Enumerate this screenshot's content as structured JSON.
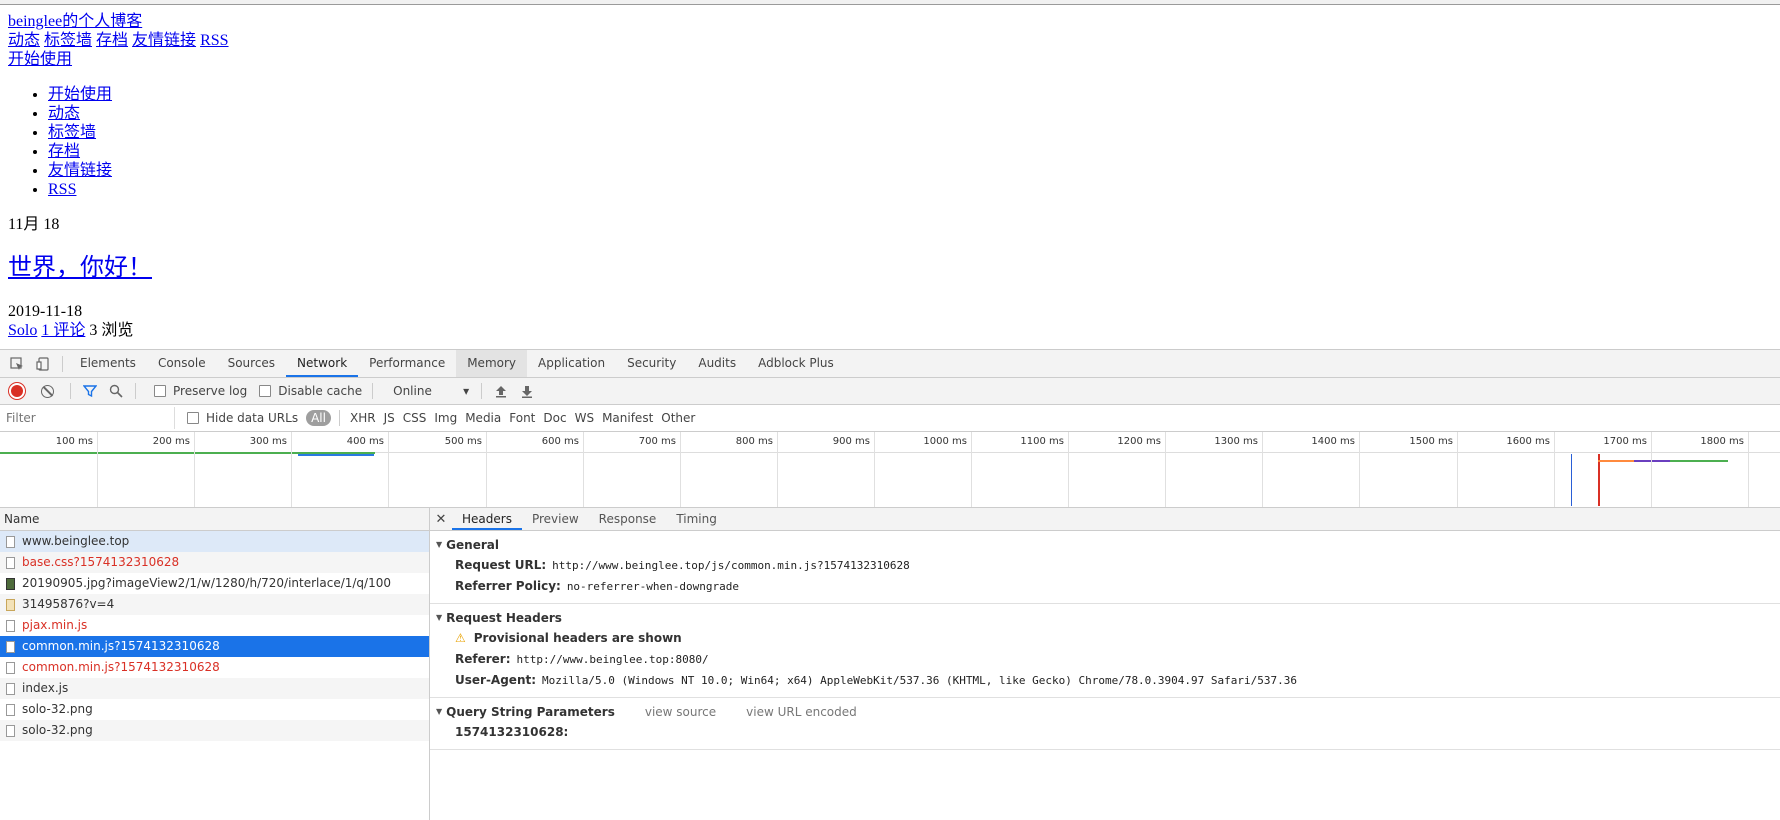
{
  "page": {
    "site_title": "beinglee的个人博客",
    "nav_links": [
      "动态",
      "标签墙",
      "存档",
      "友情链接",
      "RSS"
    ],
    "start_link": "开始使用",
    "menu": [
      "开始使用",
      "动态",
      "标签墙",
      "存档",
      "友情链接",
      "RSS"
    ],
    "date_month": "11月 18",
    "post_title": "世界，你好！",
    "post_date": "2019-11-18",
    "post_author": "Solo",
    "post_comments": "1 评论",
    "post_views": "3 浏览"
  },
  "devtools": {
    "tabs": [
      "Elements",
      "Console",
      "Sources",
      "Network",
      "Performance",
      "Memory",
      "Application",
      "Security",
      "Audits",
      "Adblock Plus"
    ],
    "active_tab": "Network",
    "toolbar": {
      "preserve_log": "Preserve log",
      "disable_cache": "Disable cache",
      "throttle": "Online"
    },
    "filter": {
      "placeholder": "Filter",
      "hide_data_urls": "Hide data URLs",
      "types": [
        "All",
        "XHR",
        "JS",
        "CSS",
        "Img",
        "Media",
        "Font",
        "Doc",
        "WS",
        "Manifest",
        "Other"
      ]
    },
    "timeline_ticks": [
      "100 ms",
      "200 ms",
      "300 ms",
      "400 ms",
      "500 ms",
      "600 ms",
      "700 ms",
      "800 ms",
      "900 ms",
      "1000 ms",
      "1100 ms",
      "1200 ms",
      "1300 ms",
      "1400 ms",
      "1500 ms",
      "1600 ms",
      "1700 ms",
      "1800 ms"
    ],
    "requests_header": "Name",
    "requests": [
      {
        "name": "www.beinglee.top",
        "status": "highlight",
        "icon": "doc"
      },
      {
        "name": "base.css?1574132310628",
        "status": "error",
        "icon": "doc"
      },
      {
        "name": "20190905.jpg?imageView2/1/w/1280/h/720/interlace/1/q/100",
        "status": "normal",
        "icon": "image"
      },
      {
        "name": "31495876?v=4",
        "status": "normal",
        "icon": "image-light"
      },
      {
        "name": "pjax.min.js",
        "status": "error",
        "icon": "doc"
      },
      {
        "name": "common.min.js?1574132310628",
        "status": "selected",
        "icon": "doc"
      },
      {
        "name": "common.min.js?1574132310628",
        "status": "error",
        "icon": "doc"
      },
      {
        "name": "index.js",
        "status": "normal",
        "icon": "doc"
      },
      {
        "name": "solo-32.png",
        "status": "normal",
        "icon": "doc"
      },
      {
        "name": "solo-32.png",
        "status": "normal",
        "icon": "doc"
      }
    ],
    "detail_tabs": [
      "Headers",
      "Preview",
      "Response",
      "Timing"
    ],
    "general": {
      "title": "General",
      "request_url_label": "Request URL:",
      "request_url": "http://www.beinglee.top/js/common.min.js?1574132310628",
      "referrer_policy_label": "Referrer Policy:",
      "referrer_policy": "no-referrer-when-downgrade"
    },
    "request_headers": {
      "title": "Request Headers",
      "warning": "Provisional headers are shown",
      "referer_label": "Referer:",
      "referer": "http://www.beinglee.top:8080/",
      "user_agent_label": "User-Agent:",
      "user_agent": "Mozilla/5.0 (Windows NT 10.0; Win64; x64) AppleWebKit/537.36 (KHTML, like Gecko) Chrome/78.0.3904.97 Safari/537.36"
    },
    "query_params": {
      "title": "Query String Parameters",
      "view_source": "view source",
      "view_url_encoded": "view URL encoded",
      "param": "1574132310628:"
    }
  },
  "colors": {
    "accent": "#1a73e8",
    "error": "#d93025",
    "link": "#0000ee"
  }
}
